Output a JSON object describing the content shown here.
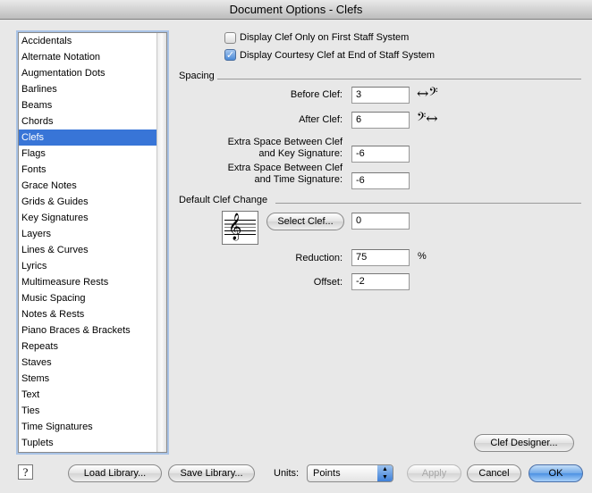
{
  "window": {
    "title": "Document Options - Clefs"
  },
  "sidebar": {
    "selected": "Clefs",
    "items": [
      "Accidentals",
      "Alternate Notation",
      "Augmentation Dots",
      "Barlines",
      "Beams",
      "Chords",
      "Clefs",
      "Flags",
      "Fonts",
      "Grace Notes",
      "Grids & Guides",
      "Key Signatures",
      "Layers",
      "Lines & Curves",
      "Lyrics",
      "Multimeasure Rests",
      "Music Spacing",
      "Notes & Rests",
      "Piano Braces & Brackets",
      "Repeats",
      "Staves",
      "Stems",
      "Text",
      "Ties",
      "Time Signatures",
      "Tuplets"
    ]
  },
  "options": {
    "first_staff_only": {
      "label": "Display Clef Only on First Staff System",
      "checked": false
    },
    "courtesy_clef": {
      "label": "Display Courtesy Clef at End of Staff System",
      "checked": true
    }
  },
  "spacing": {
    "title": "Spacing",
    "before_label": "Before Clef:",
    "before_value": "3",
    "after_label": "After Clef:",
    "after_value": "6",
    "key_label1": "Extra Space Between Clef",
    "key_label2": "and Key Signature:",
    "key_value": "-6",
    "time_label1": "Extra Space Between Clef",
    "time_label2": "and Time Signature:",
    "time_value": "-6"
  },
  "default_change": {
    "title": "Default Clef Change",
    "select_button": "Select Clef...",
    "clef_value": "0",
    "reduction_label": "Reduction:",
    "reduction_value": "75",
    "percent": "%",
    "offset_label": "Offset:",
    "offset_value": "-2"
  },
  "buttons": {
    "clef_designer": "Clef Designer...",
    "help": "?",
    "load": "Load Library...",
    "save": "Save Library...",
    "units_label": "Units:",
    "units_value": "Points",
    "apply": "Apply",
    "cancel": "Cancel",
    "ok": "OK"
  }
}
